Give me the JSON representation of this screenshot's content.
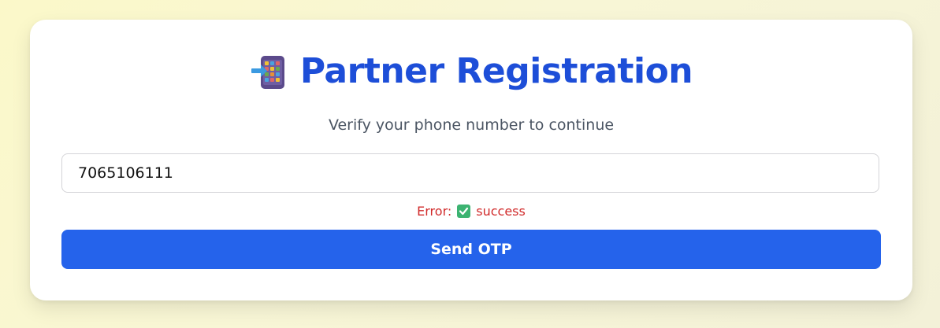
{
  "form": {
    "title": "Partner Registration",
    "title_icon": "mobile-phone-arrow-icon",
    "subtitle": "Verify your phone number to continue",
    "phone_value": "7065106111",
    "status_prefix": "Error:",
    "status_icon": "check-mark-button-icon",
    "status_text": "success",
    "submit_label": "Send OTP"
  },
  "colors": {
    "accent": "#2563eb",
    "title": "#1d4ed8",
    "error": "#d12b2b",
    "subtitle": "#4b5563"
  }
}
